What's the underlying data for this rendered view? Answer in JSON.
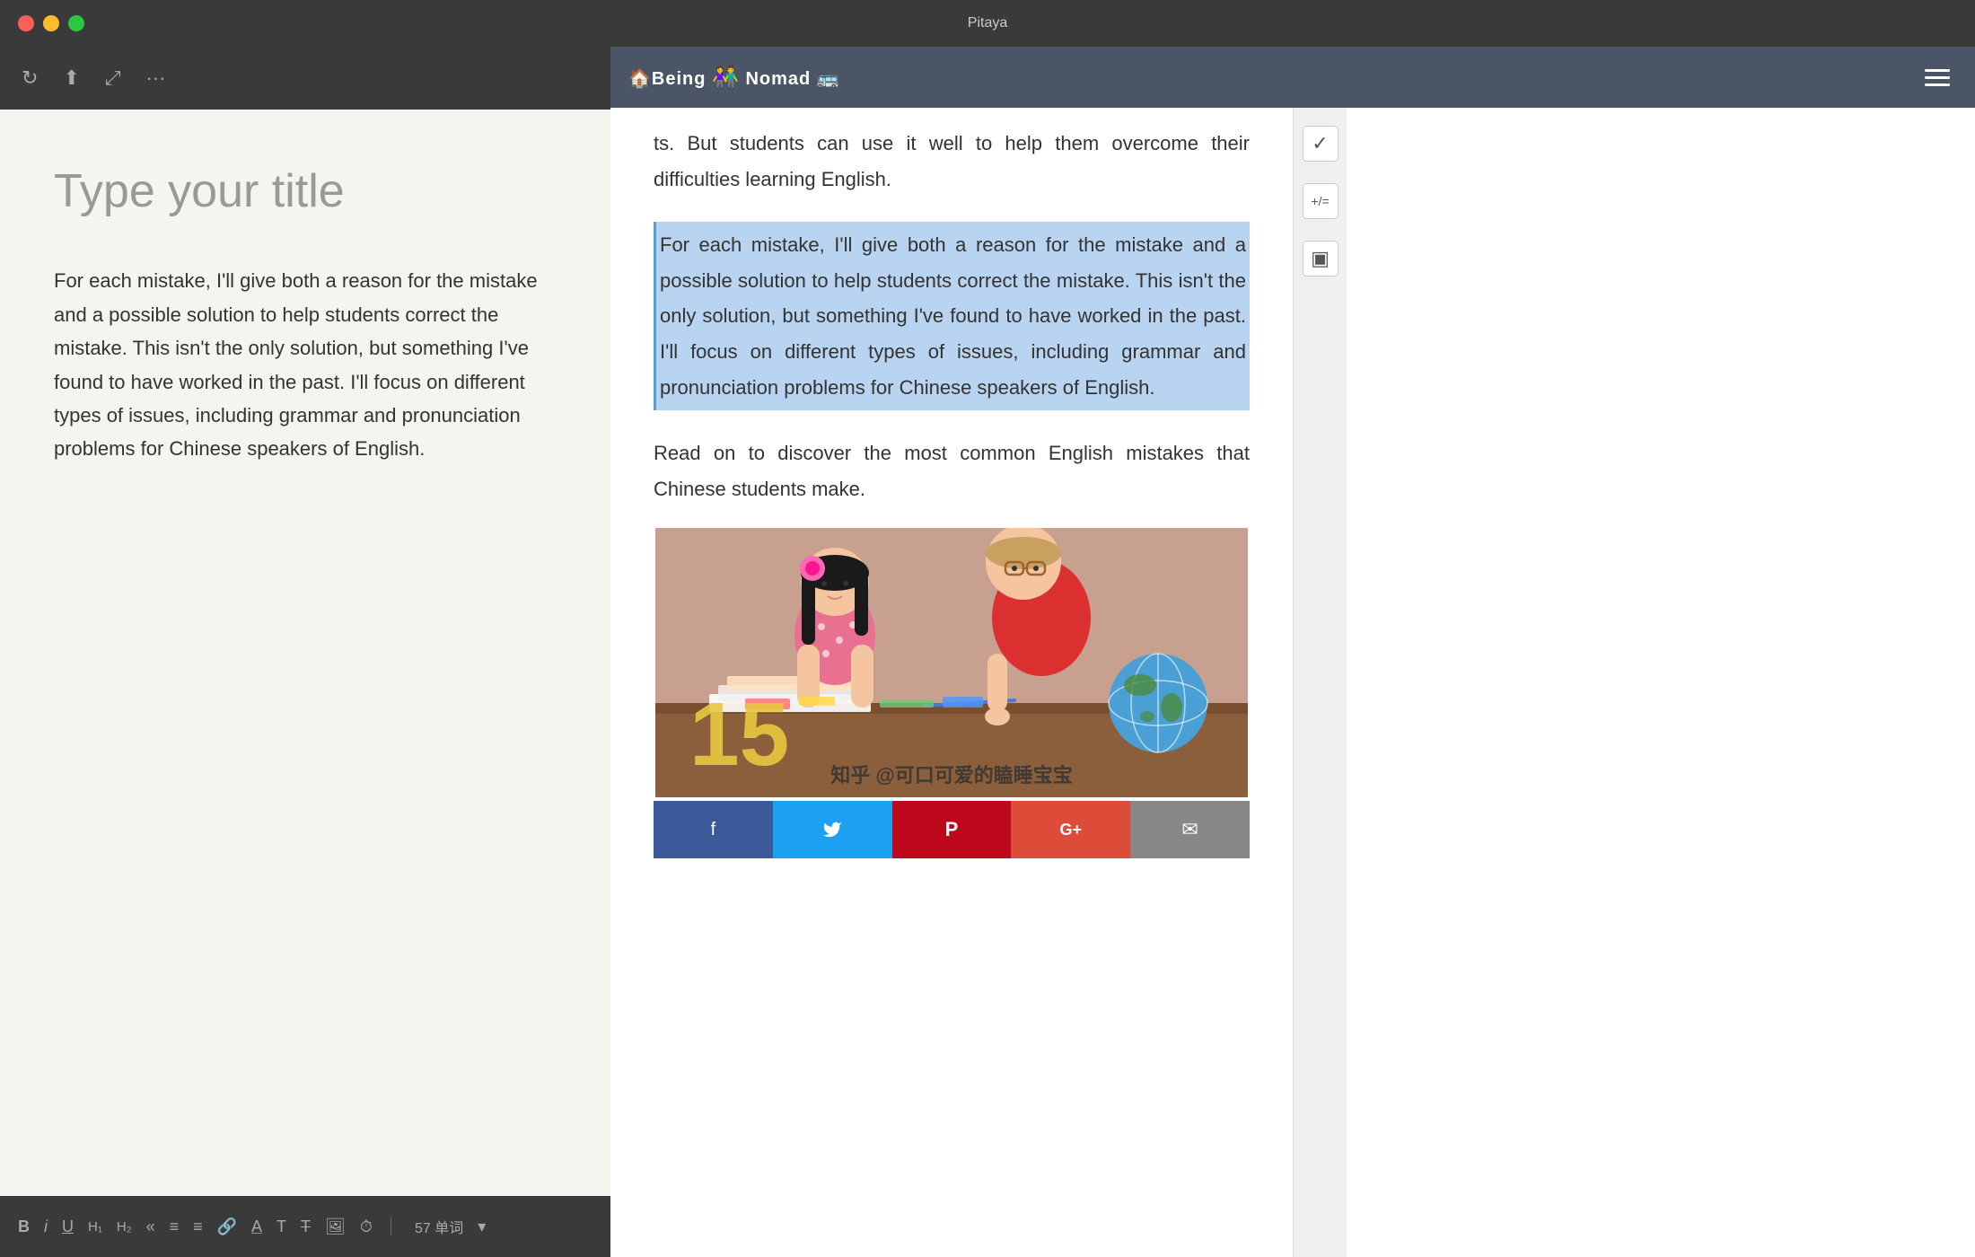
{
  "app": {
    "title": "Pitaya"
  },
  "titlebar": {
    "buttons": {
      "close": "×",
      "minimize": "−",
      "maximize": "+"
    }
  },
  "toolbar": {
    "refresh_icon": "↻",
    "share_icon": "⬆",
    "fullscreen_icon": "⤢",
    "more_icon": "···"
  },
  "editor": {
    "title_placeholder": "Type your title",
    "body_text": "For each mistake, I'll give both a reason for the mistake and a possible solution to help students correct the mistake. This isn't the only solution, but something I've found to have worked in the past. I'll focus on different types of issues, including grammar and pronunciation problems for Chinese speakers of English."
  },
  "format_bar": {
    "bold": "B",
    "italic": "i",
    "underline": "U",
    "h1": "H₁",
    "h2": "H₂",
    "quote_open": "«",
    "list_bullet": "≡",
    "list_ordered": "≡",
    "link": "🔗",
    "text_color": "A",
    "font_T": "T",
    "strikethrough": "T̶",
    "image_icon": "🖼",
    "clock_icon": "⏱",
    "word_count": "57 单词",
    "dropdown": "▾"
  },
  "browser": {
    "logo_left": "🏠Being",
    "logo_middle": "👤👤",
    "logo_right": "Nomad",
    "logo_icon_right": "🚌",
    "hamburger_label": "menu"
  },
  "article": {
    "intro_text": "ts. But students can use it well to help them overcome their difficulties learning English.",
    "highlighted_text": "For each mistake, I'll give both a reason for the mistake and a possible solution to help students correct the mistake. This isn't the only solution, but something I've found to have worked in the past. I'll focus on different types of issues, including grammar and pronunciation problems for Chinese speakers of English.",
    "read_on_text": "Read on to discover the most common English mistakes that Chinese students make.",
    "number_badge": "15",
    "zhihu_watermark": "知乎 @可口可爱的瞌睡宝宝"
  },
  "social": {
    "facebook": "f",
    "twitter": "🐦",
    "pinterest": "P",
    "gplus": "G+",
    "email": "✉"
  },
  "sidebar_icons": {
    "checkbox": "✓",
    "formula": "+/=",
    "stamp": "▣"
  }
}
